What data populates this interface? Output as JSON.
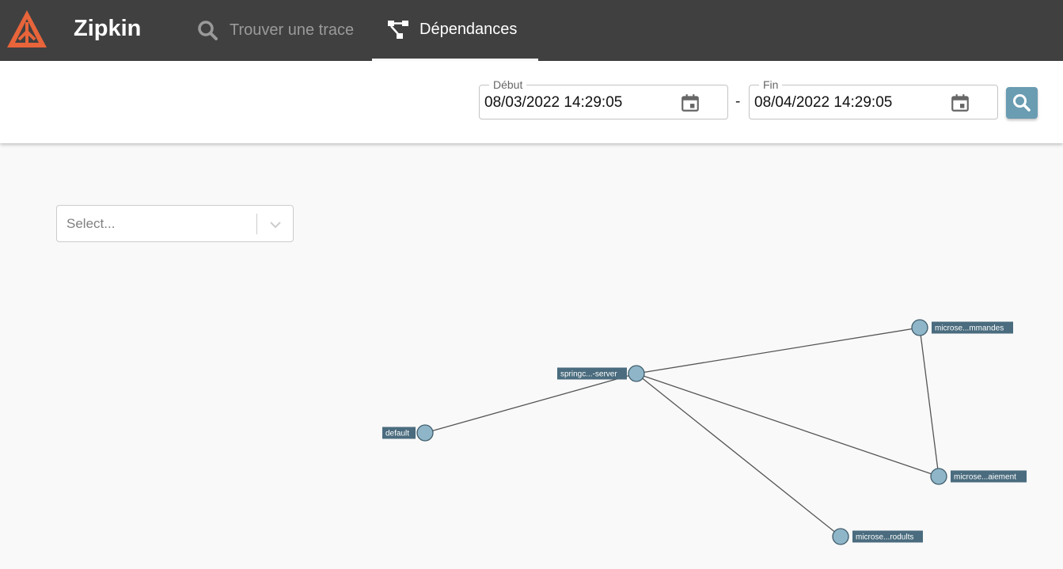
{
  "app": {
    "title": "Zipkin",
    "colors": {
      "header_bg": "#404040",
      "logo": "#e8643a",
      "accent": "#6a9cb2",
      "node_fill": "#8fb5c8",
      "label_bg": "#4a6c7e"
    }
  },
  "nav": {
    "tabs": [
      {
        "label": "Trouver une trace",
        "icon": "search-icon",
        "active": false
      },
      {
        "label": "Dépendances",
        "icon": "dependencies-icon",
        "active": true
      }
    ]
  },
  "filters": {
    "start": {
      "legend": "Début",
      "value": "08/03/2022 14:29:05",
      "icon": "calendar-icon"
    },
    "separator": "-",
    "end": {
      "legend": "Fin",
      "value": "08/04/2022 14:29:05",
      "icon": "calendar-icon"
    },
    "search_icon": "search-icon"
  },
  "service_select": {
    "placeholder": "Select...",
    "icon": "chevron-down-icon"
  },
  "graph": {
    "nodes": [
      {
        "id": "springc",
        "label": "springc...-server"
      },
      {
        "id": "default",
        "label": "default"
      },
      {
        "id": "mmandes",
        "label": "microse...mmandes"
      },
      {
        "id": "aiement",
        "label": "microse...aiement"
      },
      {
        "id": "rodults",
        "label": "microse...rodults"
      }
    ],
    "edges": [
      {
        "from": "default",
        "to": "springc"
      },
      {
        "from": "springc",
        "to": "mmandes"
      },
      {
        "from": "springc",
        "to": "aiement"
      },
      {
        "from": "springc",
        "to": "rodults"
      },
      {
        "from": "mmandes",
        "to": "aiement"
      }
    ]
  }
}
